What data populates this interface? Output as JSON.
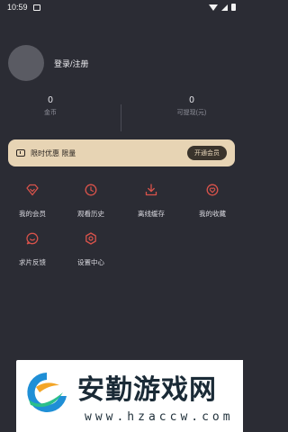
{
  "status_bar": {
    "time": "10:59"
  },
  "profile": {
    "login_label": "登录/注册"
  },
  "stats": [
    {
      "value": "0",
      "label": "金币"
    },
    {
      "value": "0",
      "label": "可提现(元)"
    }
  ],
  "vip_banner": {
    "text": "限时优惠 限量",
    "button_label": "开通会员"
  },
  "menu": [
    {
      "label": "我的会员",
      "icon": "diamond-icon"
    },
    {
      "label": "观看历史",
      "icon": "clock-icon"
    },
    {
      "label": "离线缓存",
      "icon": "download-icon"
    },
    {
      "label": "我的收藏",
      "icon": "heart-icon"
    },
    {
      "label": "求片反馈",
      "icon": "chat-icon"
    },
    {
      "label": "设置中心",
      "icon": "gear-icon"
    }
  ],
  "watermark": {
    "title": "安勤游戏网",
    "url": "www.hzaccw.com"
  },
  "colors": {
    "background": "#2b2c34",
    "accent": "#d9534b",
    "vip_gold": "#e7d4b4"
  }
}
